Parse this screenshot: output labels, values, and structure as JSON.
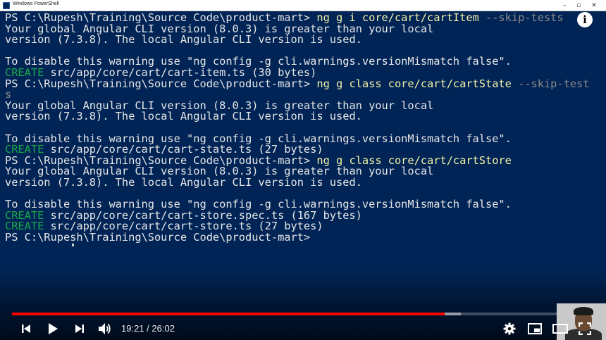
{
  "window": {
    "title": "Windows PowerShell",
    "minimize_glyph": "–",
    "maximize_glyph": "▫",
    "close_glyph": "✕"
  },
  "colors": {
    "console_bg": "#012456",
    "console_text": "#e6e6e6",
    "create_green": "#17a84a",
    "command_yellow": "#f2f2a6",
    "flag_gray": "#8a8a8a",
    "progress_red": "#ff0000"
  },
  "console": {
    "lines": [
      {
        "segments": [
          {
            "text": "PS C:\\Rupesh\\Training\\Source Code\\product-mart> "
          },
          {
            "text": "ng g i core/cart/cartItem",
            "style": "cmd"
          },
          {
            "text": " --skip-tests",
            "style": "flag"
          }
        ]
      },
      {
        "segments": [
          {
            "text": "Your global Angular CLI version (8.0.3) is greater than your local"
          }
        ]
      },
      {
        "segments": [
          {
            "text": "version (7.3.8). The local Angular CLI version is used."
          }
        ]
      },
      {
        "segments": [
          {
            "text": ""
          }
        ]
      },
      {
        "segments": [
          {
            "text": "To disable this warning use \"ng config -g cli.warnings.versionMismatch false\"."
          }
        ]
      },
      {
        "segments": [
          {
            "text": "CREATE",
            "style": "create"
          },
          {
            "text": " src/app/core/cart/cart-item.ts (30 bytes)"
          }
        ]
      },
      {
        "segments": [
          {
            "text": "PS C:\\Rupesh\\Training\\Source Code\\product-mart> "
          },
          {
            "text": "ng g class core/cart/cartState",
            "style": "cmd"
          },
          {
            "text": " --skip-test",
            "style": "flag"
          }
        ]
      },
      {
        "segments": [
          {
            "text": "s",
            "style": "flag"
          }
        ]
      },
      {
        "segments": [
          {
            "text": "Your global Angular CLI version (8.0.3) is greater than your local"
          }
        ]
      },
      {
        "segments": [
          {
            "text": "version (7.3.8). The local Angular CLI version is used."
          }
        ]
      },
      {
        "segments": [
          {
            "text": ""
          }
        ]
      },
      {
        "segments": [
          {
            "text": "To disable this warning use \"ng config -g cli.warnings.versionMismatch false\"."
          }
        ]
      },
      {
        "segments": [
          {
            "text": "CREATE",
            "style": "create"
          },
          {
            "text": " src/app/core/cart/cart-state.ts (27 bytes)"
          }
        ]
      },
      {
        "segments": [
          {
            "text": "PS C:\\Rupesh\\Training\\Source Code\\product-mart> "
          },
          {
            "text": "ng g class core/cart/cartStore",
            "style": "cmd"
          }
        ]
      },
      {
        "segments": [
          {
            "text": "Your global Angular CLI version (8.0.3) is greater than your local"
          }
        ]
      },
      {
        "segments": [
          {
            "text": "version (7.3.8). The local Angular CLI version is used."
          }
        ]
      },
      {
        "segments": [
          {
            "text": ""
          }
        ]
      },
      {
        "segments": [
          {
            "text": "To disable this warning use \"ng config -g cli.warnings.versionMismatch false\"."
          }
        ]
      },
      {
        "segments": [
          {
            "text": "CREATE",
            "style": "create"
          },
          {
            "text": " src/app/core/cart/cart-store.spec.ts (167 bytes)"
          }
        ]
      },
      {
        "segments": [
          {
            "text": "CREATE",
            "style": "create"
          },
          {
            "text": " src/app/core/cart/cart-store.ts (27 bytes)"
          }
        ]
      },
      {
        "segments": [
          {
            "text": "PS C:\\Rupesh\\Training\\Source Code\\product-mart>"
          }
        ]
      }
    ]
  },
  "player": {
    "info_glyph": "i",
    "time_current": "19:21",
    "time_separator": " / ",
    "time_total": "26:02",
    "played_fraction": 0.7431,
    "buffered_fraction": 0.7712
  },
  "icons": {
    "info": "info-icon",
    "previous": "skip-previous-icon",
    "play": "play-icon",
    "next": "skip-next-icon",
    "volume": "volume-icon",
    "settings": "gear-icon",
    "miniplayer": "miniplayer-icon",
    "theater": "theater-mode-icon",
    "fullscreen": "fullscreen-icon"
  }
}
